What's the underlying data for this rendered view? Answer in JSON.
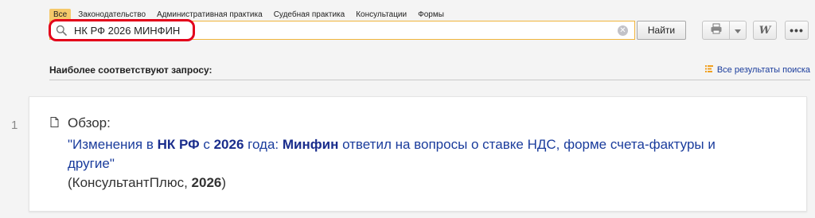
{
  "tabs": [
    "Все",
    "Законодательство",
    "Административная практика",
    "Судебная практика",
    "Консультации",
    "Формы"
  ],
  "search": {
    "value": "НК РФ 2026 МИНФИН",
    "find_label": "Найти",
    "clear_symbol": "✕"
  },
  "toolbar": {
    "print_icon": "printer-icon",
    "dropdown_icon": "chevron-down-icon",
    "word_label": "W",
    "more_label": "•••"
  },
  "results_header": {
    "heading": "Наиболее соответствуют запросу:",
    "all_results": "Все результаты поиска"
  },
  "results": [
    {
      "number": "1",
      "type": "Обзор:",
      "title_parts": [
        {
          "text": "\"Изменения в ",
          "bold": false
        },
        {
          "text": "НК РФ",
          "bold": true
        },
        {
          "text": " с ",
          "bold": false
        },
        {
          "text": "2026",
          "bold": true
        },
        {
          "text": " года: ",
          "bold": false
        },
        {
          "text": "Минфин",
          "bold": true
        },
        {
          "text": " ответил на вопросы о ставке НДС, форме счета-фактуры и другие\"",
          "bold": false
        }
      ],
      "source_parts": [
        {
          "text": "(КонсультантПлюс, ",
          "bold": false
        },
        {
          "text": "2026",
          "bold": true
        },
        {
          "text": ")",
          "bold": false
        }
      ]
    }
  ],
  "colors": {
    "active_tab": "#f5c96b",
    "search_border": "#f0b43c",
    "highlight": "#e3001b",
    "link": "#1a3c9c"
  }
}
